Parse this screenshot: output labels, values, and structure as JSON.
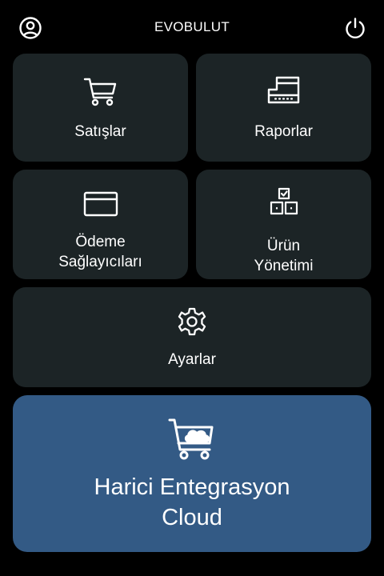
{
  "header": {
    "title": "EVOBULUT",
    "profile_icon": "user-circle-icon",
    "power_icon": "power-icon"
  },
  "tiles": {
    "sales": {
      "label": "Satışlar",
      "icon": "cart-icon"
    },
    "reports": {
      "label": "Raporlar",
      "icon": "receipt-printer-icon"
    },
    "payment": {
      "label_line1": "Ödeme",
      "label_line2": "Sağlayıcıları",
      "icon": "credit-card-icon"
    },
    "products": {
      "label_line1": "Ürün",
      "label_line2": "Yönetimi",
      "icon": "boxes-icon"
    },
    "settings": {
      "label": "Ayarlar",
      "icon": "gear-icon"
    },
    "cloud": {
      "label_line1": "Harici Entegrasyon",
      "label_line2": "Cloud",
      "icon": "cart-cloud-icon"
    }
  },
  "colors": {
    "background": "#000000",
    "tile": "#1c2426",
    "accent_tile": "#335a85",
    "text": "#ffffff"
  }
}
